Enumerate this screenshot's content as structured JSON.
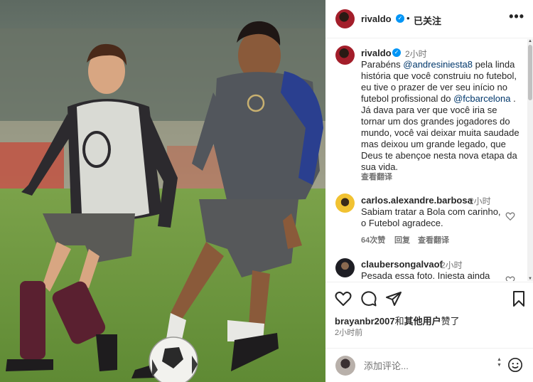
{
  "post": {
    "author": "rivaldo",
    "separator": "•",
    "follow_status": "已关注",
    "more_label": "•••"
  },
  "caption": {
    "author": "rivaldo",
    "time": "2小时",
    "text_1": "Parabéns ",
    "mention_1": "@andresiniesta8",
    "text_2": " pela linda história que você construiu no futebol, eu tive o prazer de ver seu início no futebol profissional do ",
    "mention_2": "@fcbarcelona",
    "text_3": " . Já dava para ver que você iria se tornar um dos grandes jogadores do mundo, você vai deixar muita saudade mas deixou um grande legado, que Deus te abençoe nesta nova etapa da sua vida.",
    "see_translation": "查看翻译"
  },
  "comments": [
    {
      "username": "carlos.alexandre.barbosa",
      "time": "2小时",
      "text": "Sabiam tratar a Bola com carinho, o Futebol agradece.",
      "likes": "64次赞",
      "reply": "回复",
      "see_translation": "查看翻译"
    },
    {
      "username": "claubersongalvaof",
      "time": "2小时",
      "text": "Pesada essa foto. Iniesta ainda"
    }
  ],
  "likes": {
    "user": "brayanbr2007",
    "connector": "和",
    "others": "其他用户",
    "suffix": "赞了"
  },
  "posted_time": "2小时前",
  "comment_input": {
    "placeholder": "添加评论..."
  },
  "icons": {
    "verified": "verified-badge-icon",
    "like": "heart-icon",
    "comment": "comment-bubble-icon",
    "share": "paper-plane-icon",
    "save": "bookmark-icon",
    "emoji": "smiley-icon"
  },
  "colors": {
    "verified_blue": "#0095f6",
    "mention_blue": "#00376b",
    "muted_text": "#737373"
  }
}
